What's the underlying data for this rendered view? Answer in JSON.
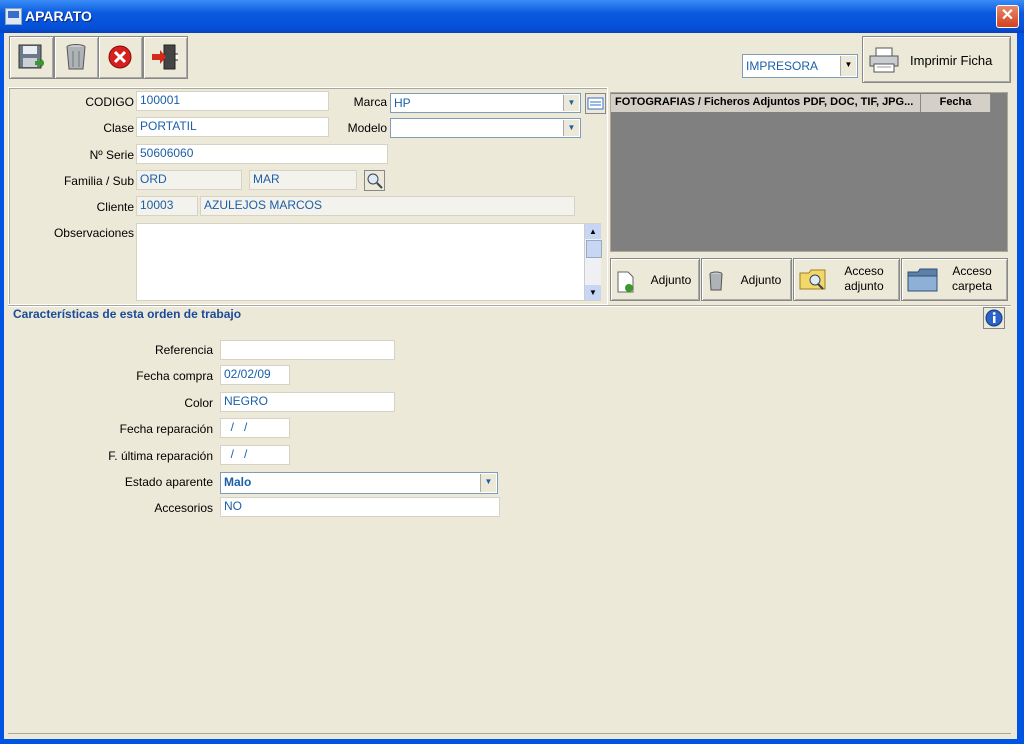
{
  "window": {
    "title": "APARATO",
    "close_icon": "close-icon"
  },
  "toolbar": {
    "buttons": [
      {
        "name": "save-button",
        "icon": "floppy-disk-icon"
      },
      {
        "name": "delete-button",
        "icon": "trash-can-icon"
      },
      {
        "name": "cancel-button",
        "icon": "red-x-icon"
      },
      {
        "name": "exit-button",
        "icon": "exit-door-icon"
      }
    ],
    "printer_select": "IMPRESORA",
    "print_label": "Imprimir Ficha"
  },
  "form": {
    "codigo_label": "CODIGO",
    "codigo": "100001",
    "marca_label": "Marca",
    "marca": "HP",
    "clase_label": "Clase",
    "clase": "PORTATIL",
    "modelo_label": "Modelo",
    "modelo": "",
    "serie_label": "Nº Serie",
    "serie": "50606060",
    "familia_label": "Familia / Sub",
    "familia": "ORD",
    "sub": "MAR",
    "cliente_label": "Cliente",
    "cliente_code": "10003",
    "cliente_name": "AZULEJOS MARCOS",
    "observaciones_label": "Observaciones",
    "observaciones": ""
  },
  "attachments": {
    "header_files": "FOTOGRAFIAS / Ficheros Adjuntos  PDF, DOC, TIF, JPG...",
    "header_date": "Fecha",
    "buttons": {
      "add": "Adjunto",
      "remove": "Adjunto",
      "access_attachment": "Acceso adjunto",
      "access_folder": "Acceso carpeta"
    }
  },
  "work_order": {
    "title": "Características de esta orden de trabajo",
    "referencia_label": "Referencia",
    "referencia": "",
    "fecha_compra_label": "Fecha compra",
    "fecha_compra": "02/02/09",
    "color_label": "Color",
    "color": "NEGRO",
    "fecha_reparacion_label": "Fecha reparación",
    "fecha_reparacion": "  /   /",
    "ultima_reparacion_label": "F. última reparación",
    "ultima_reparacion": "  /   /",
    "estado_label": "Estado aparente",
    "estado": "Malo",
    "accesorios_label": "Accesorios",
    "accesorios": "NO"
  },
  "colors": {
    "title_bar": "#0a5ae0",
    "value_text": "#1a5fa8",
    "window_bg": "#ece9d8"
  }
}
